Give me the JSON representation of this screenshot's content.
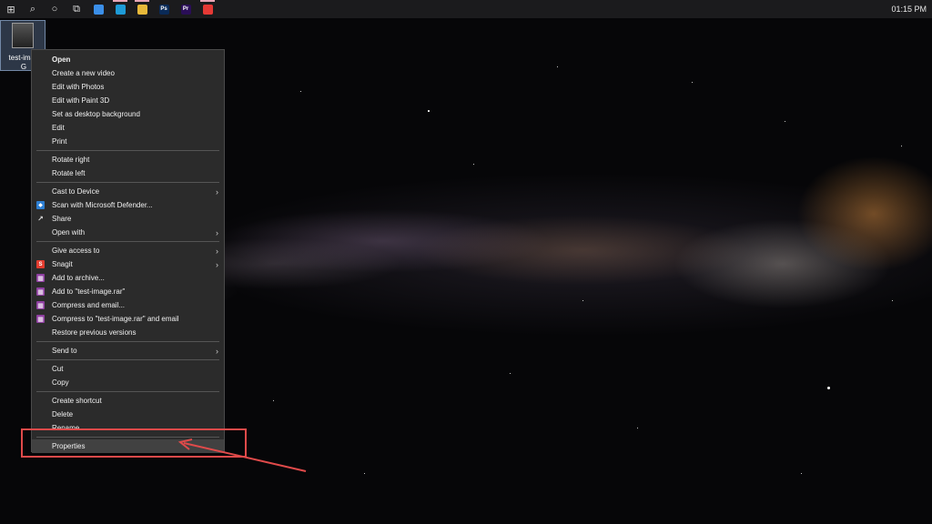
{
  "taskbar": {
    "icons": [
      {
        "name": "windows-start-icon",
        "glyph": "⊞"
      },
      {
        "name": "search-icon",
        "glyph": "⌕"
      },
      {
        "name": "cortana-icon",
        "glyph": "○"
      },
      {
        "name": "task-view-icon",
        "glyph": "⧉"
      }
    ],
    "apps": [
      {
        "name": "phone-app-icon",
        "label": "",
        "color": "#3b8fe8",
        "open": false
      },
      {
        "name": "edge-icon",
        "label": "",
        "color": "#1e9bd7",
        "open": true
      },
      {
        "name": "file-explorer-icon",
        "label": "",
        "color": "#e8b93a",
        "open": true
      },
      {
        "name": "photoshop-icon",
        "label": "Ps",
        "color": "#0a2a57",
        "open": false
      },
      {
        "name": "premiere-icon",
        "label": "Pr",
        "color": "#2a0e57",
        "open": false
      },
      {
        "name": "screen-recorder-icon",
        "label": "",
        "color": "#e53935",
        "open": true
      }
    ],
    "clock": "01:15 PM"
  },
  "desktop": {
    "icon_label": "test-imag",
    "icon_label_line2": "G"
  },
  "context_menu": {
    "items": [
      {
        "label": "Open",
        "bold": true
      },
      {
        "label": "Create a new video"
      },
      {
        "label": "Edit with Photos"
      },
      {
        "label": "Edit with Paint 3D"
      },
      {
        "label": "Set as desktop background"
      },
      {
        "label": "Edit"
      },
      {
        "label": "Print"
      },
      {
        "sep": true
      },
      {
        "label": "Rotate right"
      },
      {
        "label": "Rotate left"
      },
      {
        "sep": true
      },
      {
        "label": "Cast to Device",
        "submenu": true
      },
      {
        "label": "Scan with Microsoft Defender...",
        "icon": "defender-icon",
        "icon_color": "#2d7fd3"
      },
      {
        "label": "Share",
        "icon": "share-icon",
        "icon_color": "#2b2b2b"
      },
      {
        "label": "Open with",
        "submenu": true
      },
      {
        "sep": true
      },
      {
        "label": "Give access to",
        "submenu": true
      },
      {
        "label": "Snagit",
        "icon": "snagit-icon",
        "icon_color": "#e23b2e",
        "icon_text": "S",
        "submenu": true
      },
      {
        "label": "Add to archive...",
        "icon": "winrar-icon",
        "icon_color": "#8e3fa0"
      },
      {
        "label": "Add to \"test-image.rar\"",
        "icon": "winrar-icon",
        "icon_color": "#8e3fa0"
      },
      {
        "label": "Compress and email...",
        "icon": "winrar-icon",
        "icon_color": "#8e3fa0"
      },
      {
        "label": "Compress to \"test-image.rar\" and email",
        "icon": "winrar-icon",
        "icon_color": "#8e3fa0"
      },
      {
        "label": "Restore previous versions"
      },
      {
        "sep": true
      },
      {
        "label": "Send to",
        "submenu": true
      },
      {
        "sep": true
      },
      {
        "label": "Cut"
      },
      {
        "label": "Copy"
      },
      {
        "sep": true
      },
      {
        "label": "Create shortcut"
      },
      {
        "label": "Delete"
      },
      {
        "label": "Rename"
      },
      {
        "sep": true
      },
      {
        "label": "Properties",
        "hover": true
      }
    ]
  },
  "annotation": {
    "color": "#e04a4a"
  }
}
